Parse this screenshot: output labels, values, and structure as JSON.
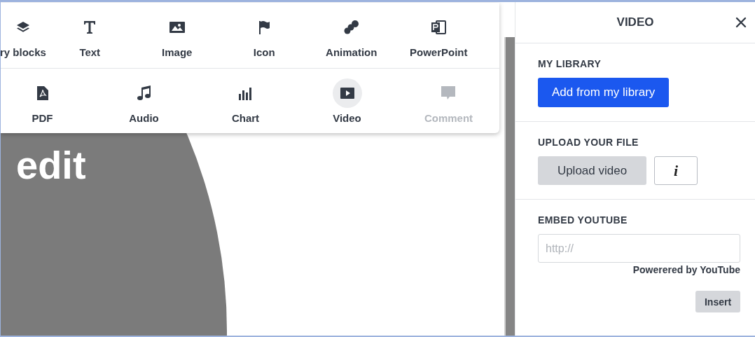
{
  "toolbar": {
    "top_items": [
      {
        "label": "ry blocks",
        "selected": false,
        "disabled": false
      },
      {
        "label": "Text",
        "selected": false,
        "disabled": false
      },
      {
        "label": "Image",
        "selected": false,
        "disabled": false
      },
      {
        "label": "Icon",
        "selected": false,
        "disabled": false
      },
      {
        "label": "Animation",
        "selected": false,
        "disabled": false
      },
      {
        "label": "PowerPoint",
        "selected": false,
        "disabled": false
      }
    ],
    "bottom_items": [
      {
        "label": "PDF",
        "selected": false,
        "disabled": false
      },
      {
        "label": "Audio",
        "selected": false,
        "disabled": false
      },
      {
        "label": "Chart",
        "selected": false,
        "disabled": false
      },
      {
        "label": "Video",
        "selected": true,
        "disabled": false
      },
      {
        "label": "Comment",
        "selected": false,
        "disabled": true
      }
    ]
  },
  "canvas": {
    "text": "edit"
  },
  "panel": {
    "title": "VIDEO",
    "my_library": {
      "heading": "MY LIBRARY",
      "button": "Add from my library"
    },
    "upload": {
      "heading": "UPLOAD YOUR FILE",
      "button": "Upload video",
      "info_button": "i"
    },
    "embed": {
      "heading": "EMBED YOUTUBE",
      "placeholder": "http://",
      "note": "Powerered by YouTube",
      "button": "Insert"
    }
  }
}
